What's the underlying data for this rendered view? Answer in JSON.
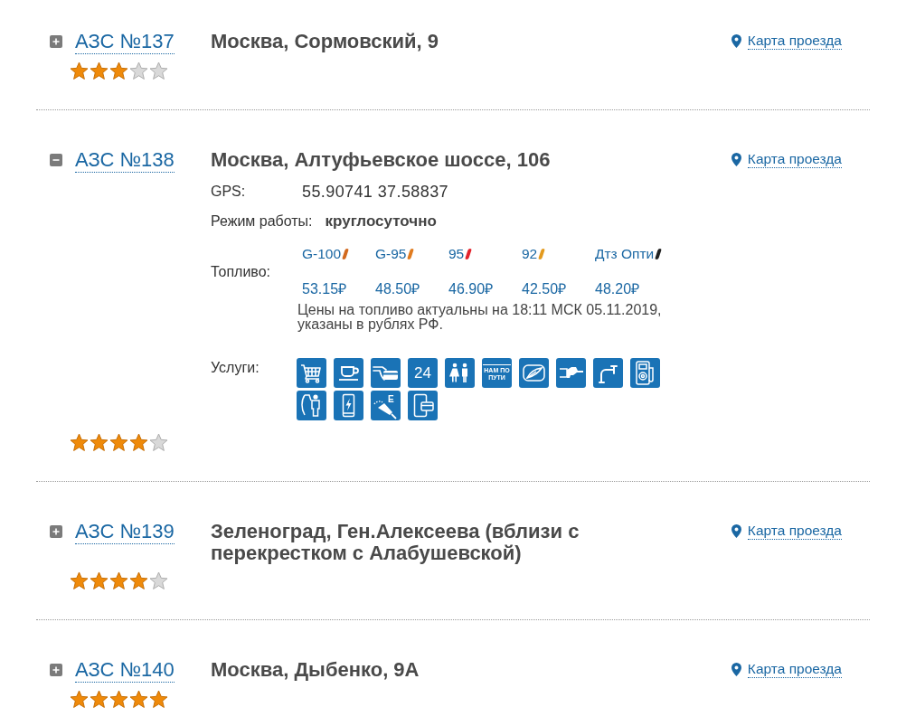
{
  "stations": [
    {
      "title": "АЗС №137",
      "address": "Москва, Сормовский, 9",
      "expanded": false,
      "stars": 3,
      "map_link": "Карта проезда"
    },
    {
      "title": "АЗС №138",
      "address": "Москва, Алтуфьевское шоссе, 106",
      "expanded": true,
      "stars": 4,
      "map_link": "Карта проезда",
      "details": {
        "gps": {
          "label": "GPS:",
          "value": "55.90741 37.58837"
        },
        "hours": {
          "label": "Режим работы:",
          "value": "круглосуточно"
        },
        "fuel": {
          "label": "Топливо:",
          "grades": [
            {
              "name": "G-100",
              "color": "#d2691e",
              "price": "53.15₽"
            },
            {
              "name": "G-95",
              "color": "#e07b1f",
              "price": "48.50₽"
            },
            {
              "name": "95",
              "color": "#e3232c",
              "price": "46.90₽"
            },
            {
              "name": "92",
              "color": "#e39a1e",
              "price": "42.50₽"
            },
            {
              "name": "Дтз Опти",
              "color": "#222222",
              "price": "48.20₽"
            }
          ],
          "note": "Цены на топливо актуальны на 18:11 МСК 05.11.2019, указаны в рублях РФ."
        },
        "services": {
          "label": "Услуги:",
          "items": [
            {
              "kind": "shop"
            },
            {
              "kind": "cafe"
            },
            {
              "kind": "card"
            },
            {
              "kind": "hours",
              "label": "24"
            },
            {
              "kind": "toilet"
            },
            {
              "kind": "slogan",
              "label": "НАМ ПО ПУТИ"
            },
            {
              "kind": "wash"
            },
            {
              "kind": "nozzle"
            },
            {
              "kind": "water"
            },
            {
              "kind": "air"
            },
            {
              "kind": "attendant"
            },
            {
              "kind": "charging"
            },
            {
              "kind": "ehand",
              "label": "E"
            },
            {
              "kind": "mobilepay"
            }
          ]
        }
      }
    },
    {
      "title": "АЗС №139",
      "address": "Зеленоград, Ген.Алексеева (вблизи с перекрестком с Алабушевской)",
      "expanded": false,
      "stars": 4,
      "map_link": "Карта проезда"
    },
    {
      "title": "АЗС №140",
      "address": "Москва, Дыбенко, 9А",
      "expanded": false,
      "stars": 5,
      "map_link": "Карта проезда"
    }
  ]
}
